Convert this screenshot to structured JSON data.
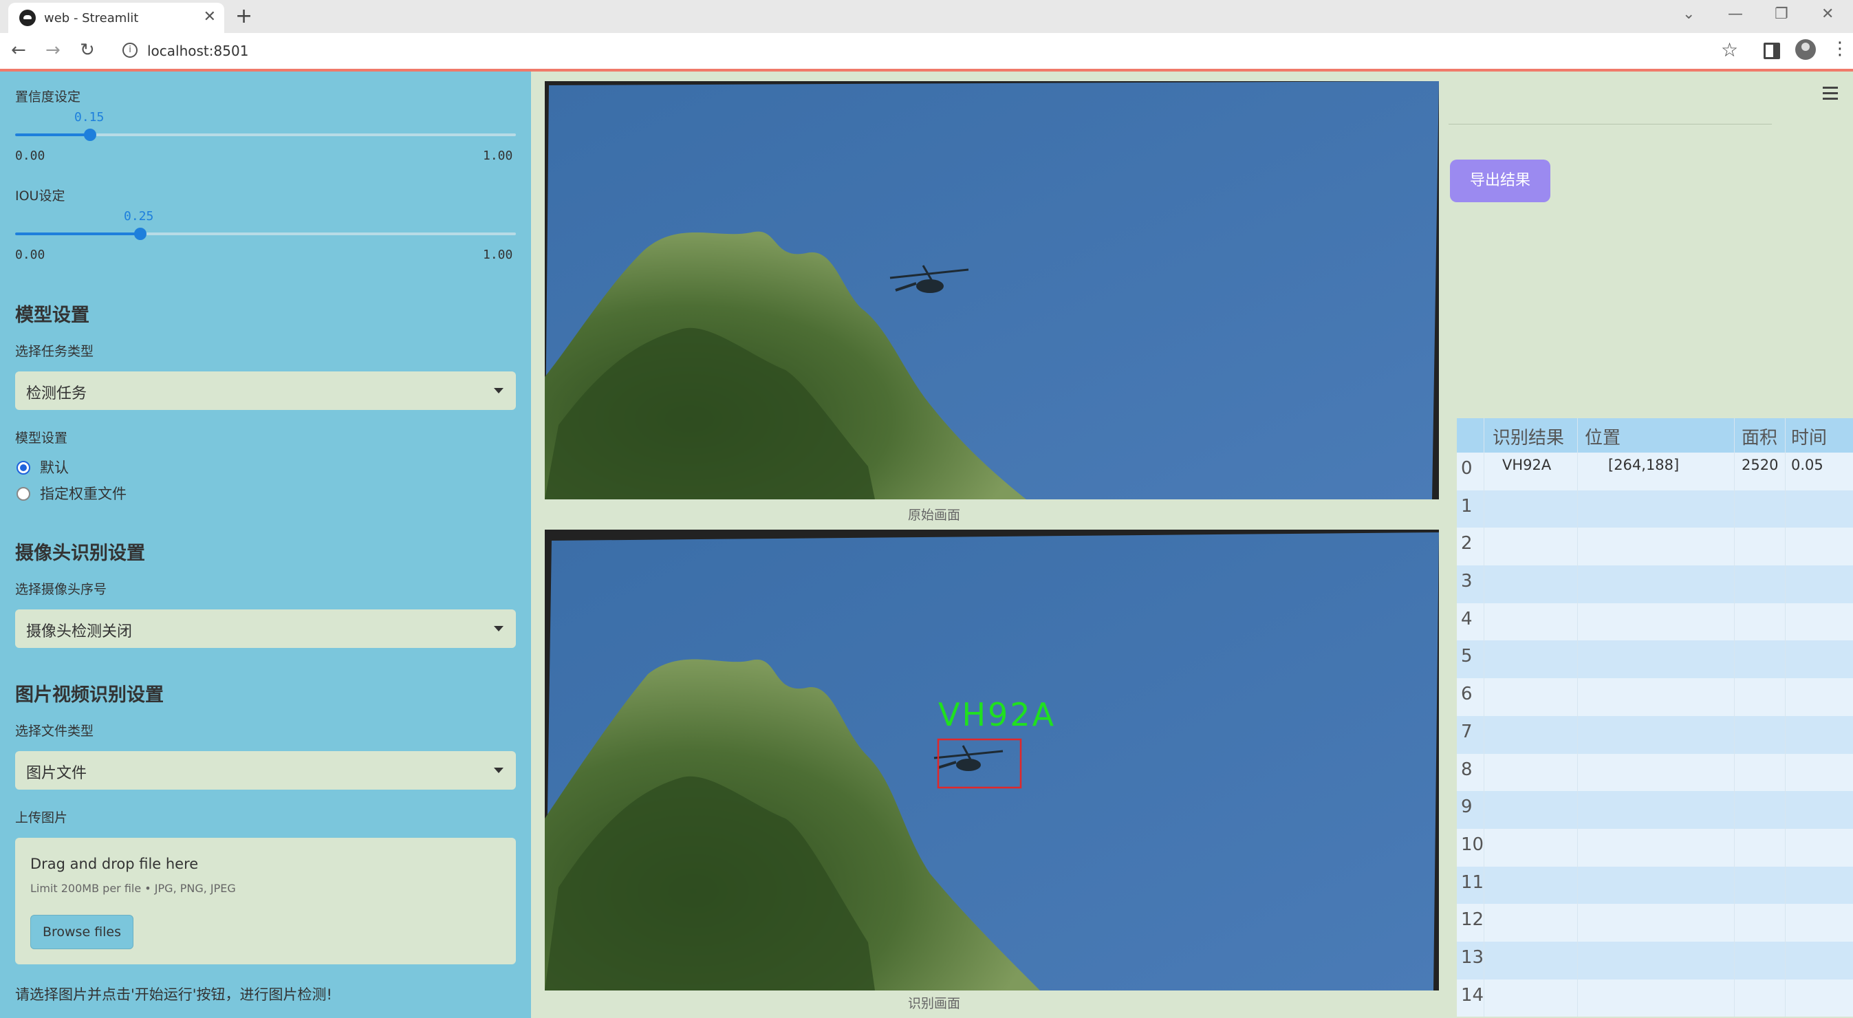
{
  "browser": {
    "tab_title": "web - Streamlit",
    "url": "localhost:8501"
  },
  "sidebar": {
    "confidence": {
      "label": "置信度设定",
      "value": "0.15",
      "min": "0.00",
      "max": "1.00",
      "fraction": 0.15
    },
    "iou": {
      "label": "IOU设定",
      "value": "0.25",
      "min": "0.00",
      "max": "1.00",
      "fraction": 0.25
    },
    "model_header": "模型设置",
    "task_label": "选择任务类型",
    "task_value": "检测任务",
    "model_label": "模型设置",
    "model_options": [
      "默认",
      "指定权重文件"
    ],
    "model_selected": "默认",
    "camera_header": "摄像头识别设置",
    "camera_label": "选择摄像头序号",
    "camera_value": "摄像头检测关闭",
    "file_header": "图片视频识别设置",
    "filetype_label": "选择文件类型",
    "filetype_value": "图片文件",
    "upload_label": "上传图片",
    "dropzone_title": "Drag and drop file here",
    "dropzone_limit": "Limit 200MB per file • JPG, PNG, JPEG",
    "browse_label": "Browse files",
    "hint": "请选择图片并点击'开始运行'按钮，进行图片检测!"
  },
  "main": {
    "caption_original": "原始画面",
    "caption_result": "识别画面",
    "detection_label": "VH92A"
  },
  "right": {
    "export_label": "导出结果",
    "table": {
      "headers": [
        "识别结果",
        "位置",
        "面积",
        "时间"
      ],
      "index_labels": [
        "0",
        "1",
        "2",
        "3",
        "4",
        "5",
        "6",
        "7",
        "8",
        "9",
        "10",
        "11",
        "12",
        "13",
        "14"
      ],
      "rows": [
        {
          "result": "VH92A",
          "position": "[264,188]",
          "area": "2520",
          "time": "0.05"
        }
      ]
    }
  },
  "colors": {
    "sidebar_bg": "#7bc6dc",
    "page_bg": "#d9e6d0",
    "slider_accent": "#1e7fdc",
    "export_button": "#9b8af0",
    "detection_box": "#e0282a",
    "detection_text": "#20e020"
  }
}
